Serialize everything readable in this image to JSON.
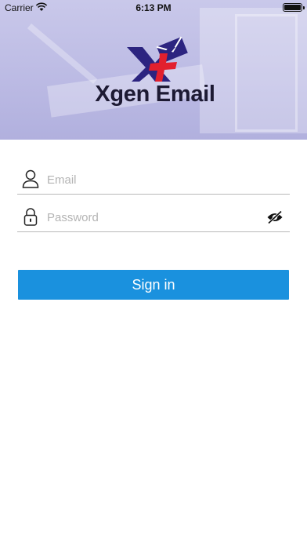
{
  "status_bar": {
    "carrier": "Carrier",
    "time": "6:13 PM",
    "wifi_icon": "wifi-icon",
    "battery_icon": "battery-icon"
  },
  "header": {
    "logo_icon": "xgen-envelope-logo-icon",
    "app_name": "Xgen Email",
    "background": "#bcbbe4"
  },
  "login_form": {
    "email": {
      "placeholder": "Email",
      "value": "",
      "icon": "user-icon"
    },
    "password": {
      "placeholder": "Password",
      "value": "",
      "icon": "lock-icon",
      "toggle_icon": "eye-slash-icon"
    },
    "signin_label": "Sign in"
  },
  "colors": {
    "accent": "#1a91de",
    "logo_navy": "#2c2480",
    "logo_red": "#e2202e",
    "divider": "#b9b9b9",
    "placeholder": "#b4b4b4"
  }
}
